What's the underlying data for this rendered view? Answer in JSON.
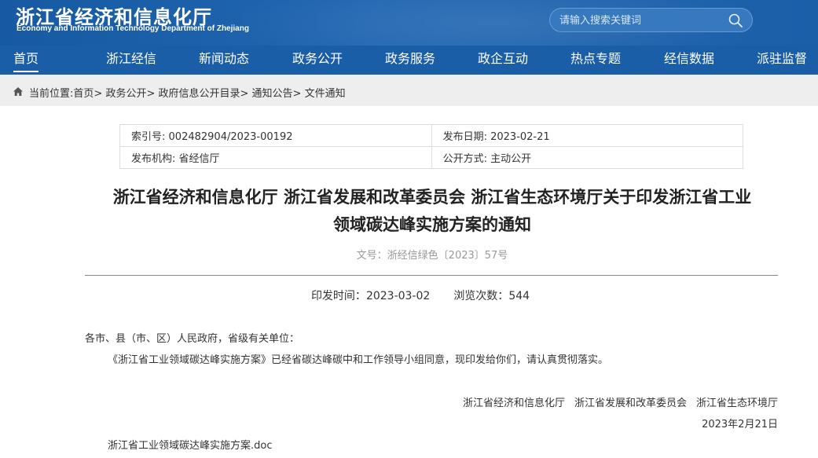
{
  "header": {
    "logo_cn": "浙江省经济和信息化厅",
    "logo_en": "Economy and Information Technology Department of Zhejiang",
    "search_placeholder": "请输入搜索关键词"
  },
  "nav": {
    "items": [
      {
        "label": "首页",
        "active": true
      },
      {
        "label": "浙江经信"
      },
      {
        "label": "新闻动态"
      },
      {
        "label": "政务公开"
      },
      {
        "label": "政务服务"
      },
      {
        "label": "政企互动"
      },
      {
        "label": "热点专题"
      },
      {
        "label": "经信数据"
      },
      {
        "label": "派驻监督"
      }
    ]
  },
  "breadcrumb": {
    "prefix": "当前位置:",
    "items": [
      "首页",
      "政务公开",
      "政府信息公开目录",
      "通知公告",
      "文件通知"
    ],
    "separator": "> "
  },
  "info": {
    "index_label": "索引号:",
    "index_value": "002482904/2023-00192",
    "date_label": "发布日期:",
    "date_value": "2023-02-21",
    "org_label": "发布机构:",
    "org_value": "省经信厅",
    "open_label": "公开方式:",
    "open_value": "主动公开"
  },
  "article": {
    "title_line1": "浙江省经济和信息化厅 浙江省发展和改革委员会 浙江省生态环境厅关于印发浙江省工业",
    "title_line2": "领域碳达峰实施方案的通知",
    "doc_no": "文号：浙经信绿色〔2023〕57号",
    "print_label": "印发时间：",
    "print_value": "2023-03-02",
    "views_label": "浏览次数：",
    "views_value": "544",
    "body_line1": "各市、县（市、区）人民政府，省级有关单位：",
    "body_line2": "《浙江省工业领域碳达峰实施方案》已经省碳达峰碳中和工作领导小组同意，现印发给你们，请认真贯彻落实。",
    "sign_org1": "浙江省经济和信息化厅",
    "sign_org2": "浙江省发展和改革委员会",
    "sign_org3": "浙江省生态环境厅",
    "sign_date": "2023年2月21日",
    "attachment": "浙江省工业领域碳达峰实施方案.doc"
  },
  "colors": {
    "header_blue": "#1a5ea8",
    "crumb_bg": "#eeeeee"
  }
}
